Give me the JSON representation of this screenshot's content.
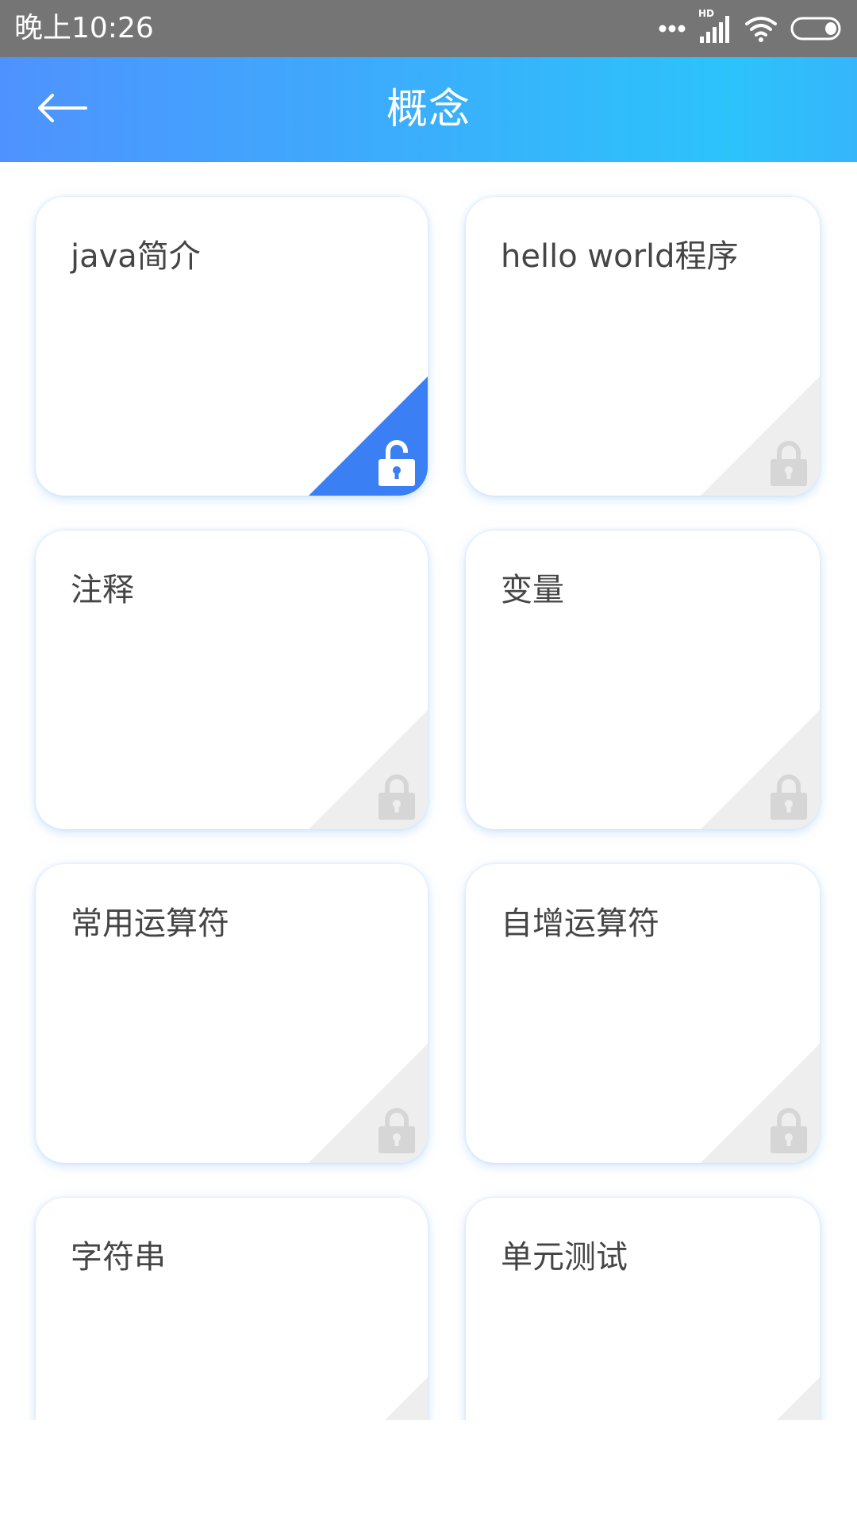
{
  "status_bar": {
    "time": "晚上10:26",
    "network_label": "HD",
    "icons": [
      "more-dots-icon",
      "signal-icon",
      "wifi-icon",
      "battery-icon"
    ]
  },
  "header": {
    "title": "概念",
    "back_icon": "arrow-left-icon"
  },
  "colors": {
    "status_bar_bg": "#757575",
    "header_gradient_start": "#4f92ff",
    "header_gradient_end": "#2cc3fb",
    "unlocked_corner": "#3b7ff5",
    "locked_corner": "#eeeeee",
    "locked_icon": "#d6d6d6",
    "card_title_text": "#454545"
  },
  "lessons": [
    {
      "title": "java简介",
      "status": "unlocked",
      "icon": "unlock-icon"
    },
    {
      "title": "hello world程序",
      "status": "locked",
      "icon": "lock-icon"
    },
    {
      "title": "注释",
      "status": "locked",
      "icon": "lock-icon"
    },
    {
      "title": "变量",
      "status": "locked",
      "icon": "lock-icon"
    },
    {
      "title": "常用运算符",
      "status": "locked",
      "icon": "lock-icon"
    },
    {
      "title": "自增运算符",
      "status": "locked",
      "icon": "lock-icon"
    },
    {
      "title": "字符串",
      "status": "locked",
      "icon": "lock-icon"
    },
    {
      "title": "单元测试",
      "status": "locked",
      "icon": "lock-icon"
    }
  ]
}
